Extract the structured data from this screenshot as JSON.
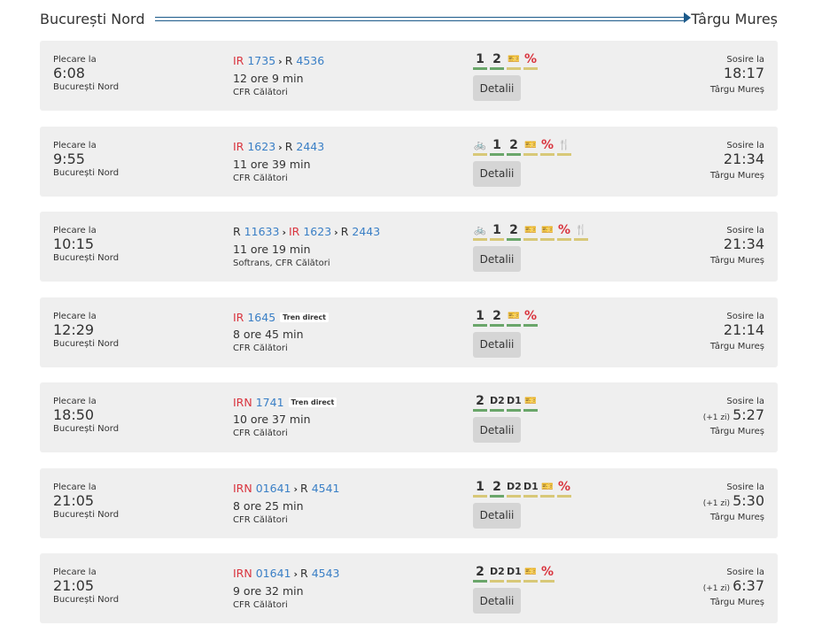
{
  "header": {
    "from": "București Nord",
    "to": "Târgu Mureș"
  },
  "labels": {
    "departure": "Plecare la",
    "arrival": "Sosire la",
    "details": "Detalii",
    "direct": "Tren direct"
  },
  "colors": {
    "available": "#6aa66a",
    "partial": "#d8c878",
    "ir": "#d9353f",
    "number": "#3a7fc6"
  },
  "trips": [
    {
      "dep": "6:08",
      "from": "București Nord",
      "trains": [
        {
          "type": "IR",
          "num": "1735"
        },
        {
          "type": "R",
          "num": "4536"
        }
      ],
      "direct": false,
      "duration": "12 ore 9 min",
      "operator": "CFR Călători",
      "facilities": [
        [
          "1",
          "g"
        ],
        [
          "2",
          "g"
        ],
        [
          "ticket-icon",
          "y"
        ],
        [
          "%",
          "y"
        ]
      ],
      "arr": "18:17",
      "plus": "",
      "to": "Târgu Mureș"
    },
    {
      "dep": "9:55",
      "from": "București Nord",
      "trains": [
        {
          "type": "IR",
          "num": "1623"
        },
        {
          "type": "R",
          "num": "2443"
        }
      ],
      "direct": false,
      "duration": "11 ore 39 min",
      "operator": "CFR Călători",
      "facilities": [
        [
          "bike-icon",
          "y"
        ],
        [
          "1",
          "g"
        ],
        [
          "2",
          "g"
        ],
        [
          "ticket-icon",
          "y"
        ],
        [
          "%",
          "y"
        ],
        [
          "restaurant-icon",
          "y"
        ]
      ],
      "arr": "21:34",
      "plus": "",
      "to": "Târgu Mureș"
    },
    {
      "dep": "10:15",
      "from": "București Nord",
      "trains": [
        {
          "type": "R",
          "num": "11633"
        },
        {
          "type": "IR",
          "num": "1623"
        },
        {
          "type": "R",
          "num": "2443"
        }
      ],
      "direct": false,
      "duration": "11 ore 19 min",
      "operator": "Softrans, CFR Călători",
      "facilities": [
        [
          "bike-icon",
          "y"
        ],
        [
          "1",
          "y"
        ],
        [
          "2",
          "g"
        ],
        [
          "ticket-icon",
          "y"
        ],
        [
          "ticket-icon",
          "y"
        ],
        [
          "%",
          "y"
        ],
        [
          "restaurant-icon",
          "y"
        ]
      ],
      "arr": "21:34",
      "plus": "",
      "to": "Târgu Mureș"
    },
    {
      "dep": "12:29",
      "from": "București Nord",
      "trains": [
        {
          "type": "IR",
          "num": "1645"
        }
      ],
      "direct": true,
      "duration": "8 ore 45 min",
      "operator": "CFR Călători",
      "facilities": [
        [
          "1",
          "g"
        ],
        [
          "2",
          "g"
        ],
        [
          "ticket-icon",
          "g"
        ],
        [
          "%",
          "g"
        ]
      ],
      "arr": "21:14",
      "plus": "",
      "to": "Târgu Mureș"
    },
    {
      "dep": "18:50",
      "from": "București Nord",
      "trains": [
        {
          "type": "IRN",
          "num": "1741"
        }
      ],
      "direct": true,
      "duration": "10 ore 37 min",
      "operator": "CFR Călători",
      "facilities": [
        [
          "2",
          "g"
        ],
        [
          "sleeper-d2-icon",
          "g"
        ],
        [
          "sleeper-d1-icon",
          "g"
        ],
        [
          "ticket-icon",
          "g"
        ]
      ],
      "arr": "5:27",
      "plus": "(+1 zi)",
      "to": "Târgu Mureș"
    },
    {
      "dep": "21:05",
      "from": "București Nord",
      "trains": [
        {
          "type": "IRN",
          "num": "01641"
        },
        {
          "type": "R",
          "num": "4541"
        }
      ],
      "direct": false,
      "duration": "8 ore 25 min",
      "operator": "CFR Călători",
      "facilities": [
        [
          "1",
          "y"
        ],
        [
          "2",
          "g"
        ],
        [
          "sleeper-d2-icon",
          "y"
        ],
        [
          "sleeper-d1-icon",
          "y"
        ],
        [
          "ticket-icon",
          "y"
        ],
        [
          "%",
          "y"
        ]
      ],
      "arr": "5:30",
      "plus": "(+1 zi)",
      "to": "Târgu Mureș"
    },
    {
      "dep": "21:05",
      "from": "București Nord",
      "trains": [
        {
          "type": "IRN",
          "num": "01641"
        },
        {
          "type": "R",
          "num": "4543"
        }
      ],
      "direct": false,
      "duration": "9 ore 32 min",
      "operator": "CFR Călători",
      "facilities": [
        [
          "2",
          "g"
        ],
        [
          "sleeper-d2-icon",
          "y"
        ],
        [
          "sleeper-d1-icon",
          "y"
        ],
        [
          "ticket-icon",
          "y"
        ],
        [
          "%",
          "y"
        ]
      ],
      "arr": "6:37",
      "plus": "(+1 zi)",
      "to": "Târgu Mureș"
    }
  ]
}
